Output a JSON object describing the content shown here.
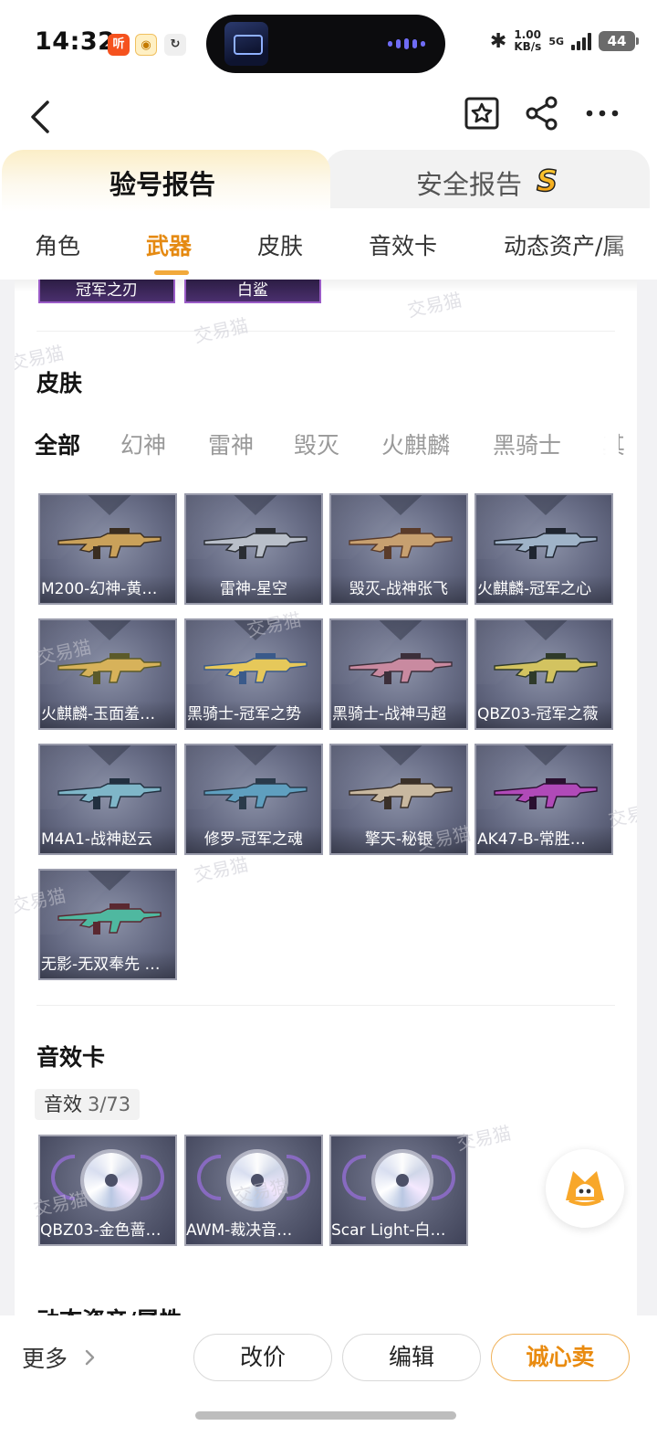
{
  "status_bar": {
    "time": "14:32",
    "app_icons": [
      "music-app-icon",
      "video-app-icon",
      "sync-app-icon"
    ],
    "speed_value": "1.00",
    "speed_unit": "KB/s",
    "network": "5G",
    "battery": "44"
  },
  "nav": {
    "icons": [
      "back-icon",
      "favorite-star-icon",
      "share-icon",
      "more-icon"
    ]
  },
  "report_tabs": {
    "active": "验号报告",
    "inactive": "安全报告",
    "badge": "S"
  },
  "category_tabs": [
    "角色",
    "武器",
    "皮肤",
    "音效卡",
    "动态资产/属"
  ],
  "category_active": "武器",
  "previous_section_chips": [
    "冠军之刃",
    "白鲨"
  ],
  "skins": {
    "title": "皮肤",
    "filters": [
      "全部",
      "幻神",
      "雷神",
      "毁灭",
      "火麒麟",
      "黑骑士",
      "其"
    ],
    "filter_active": "全部",
    "items": [
      {
        "label": "M200-幻神-黄…"
      },
      {
        "label": "雷神-星空"
      },
      {
        "label": "毁灭-战神张飞"
      },
      {
        "label": "火麒麟-冠军之心"
      },
      {
        "label": "火麒麟-玉面羞…"
      },
      {
        "label": "黑骑士-冠军之势"
      },
      {
        "label": "黑骑士-战神马超"
      },
      {
        "label": "QBZ03-冠军之薇"
      },
      {
        "label": "M4A1-战神赵云"
      },
      {
        "label": "修罗-冠军之魂"
      },
      {
        "label": "擎天-秘银"
      },
      {
        "label": "AK47-B-常胜…"
      },
      {
        "label": "无影-无双奉先 …"
      }
    ]
  },
  "sound_cards": {
    "title": "音效卡",
    "badge_label": "音效",
    "badge_count": "3/73",
    "items": [
      {
        "label": "QBZ03-金色蔷…"
      },
      {
        "label": "AWM-裁决音…"
      },
      {
        "label": "Scar Light-白…"
      }
    ]
  },
  "next_section_title_partial": "动态资产/属性",
  "watermark": "交易猫",
  "bottom_bar": {
    "more": "更多",
    "edit_price": "改价",
    "edit": "编辑",
    "sell": "诚心卖"
  },
  "colors": {
    "accent": "#e58a12",
    "tab_gradient_top": "#fbeec7",
    "card_bg": "#676c85",
    "chip_purple": "#9a5bc6"
  }
}
